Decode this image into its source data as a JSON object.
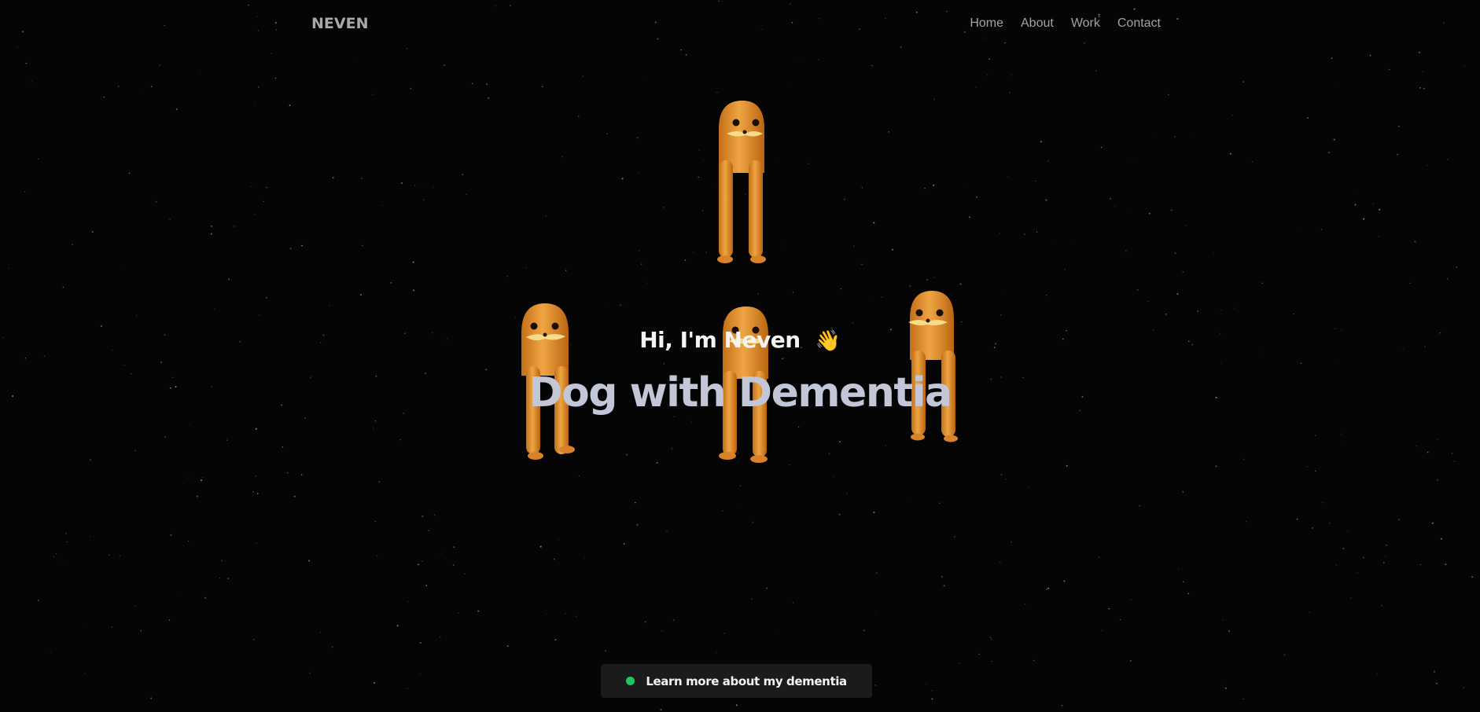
{
  "brand": {
    "name": "NEVEN"
  },
  "nav": {
    "items": [
      {
        "label": "Home"
      },
      {
        "label": "About"
      },
      {
        "label": "Work"
      },
      {
        "label": "Contact"
      }
    ]
  },
  "hero": {
    "greeting": "Hi, I'm Neven",
    "greeting_emoji": "👋",
    "headline": "Dog with Dementia",
    "creature_icon": "orange-long-legged-creature-icon",
    "creature_color": "#E89A2E"
  },
  "cta": {
    "label": "Learn more about my dementia",
    "status_color": "#22C55E"
  },
  "theme": {
    "background": "#050505",
    "headline_color": "#C3C6D7"
  }
}
